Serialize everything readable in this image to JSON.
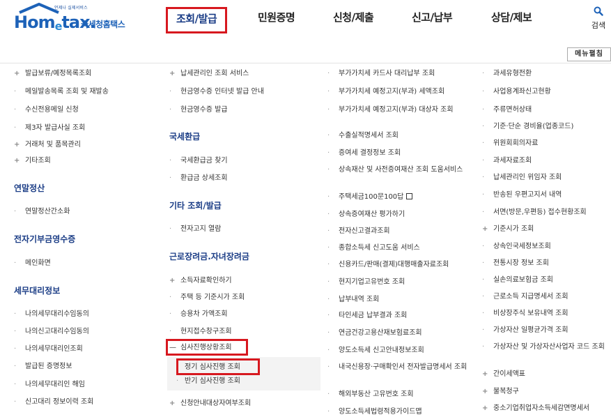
{
  "header": {
    "logo_small": "언제나 실제서비스",
    "logo_main": "Hom",
    "logo_e": "e",
    "logo_tax": "tax.",
    "logo_kor": "국세청홈택스",
    "nav": [
      "조회/발급",
      "민원증명",
      "신청/제출",
      "신고/납부",
      "상담/제보"
    ],
    "search_label": "검색"
  },
  "menu_map_button": "메뉴펼침",
  "col1": {
    "items": [
      "발급보류/예정목록조회",
      "메일발송목록 조회 및 재발송",
      "수신전용메일 신청",
      "제3자 발급사실 조회",
      "거래처 및 품목관리",
      "기타조회"
    ],
    "section1": "연말정산",
    "section1_items": [
      "연말정산간소화"
    ],
    "section2": "전자기부금영수증",
    "section2_items": [
      "메인화면"
    ],
    "section3": "세무대리정보",
    "section3_items": [
      "나의세무대리수임동의",
      "나의신고대리수임동의",
      "나의세무대리인조회",
      "발급된 증명정보",
      "나의세무대리인 해임",
      "신고대리 정보이력 조회"
    ]
  },
  "col2": {
    "items": [
      "납세관리인 조회 서비스",
      "현금영수증 인터넷 발급 안내",
      "현금영수증 발급"
    ],
    "section1": "국세환급",
    "section1_items": [
      "국세환급금 찾기",
      "환급금 상세조회"
    ],
    "section2": "기타 조회/발급",
    "section2_items": [
      "전자고지 열람"
    ],
    "section3": "근로장려금.자녀장려금",
    "section3_items": [
      "소득자료확인하기",
      "주택 등 기준시가 조회",
      "승용차 가액조회",
      "현지접수창구조회",
      "심사진행상황조회"
    ],
    "sub_items": [
      "정기 심사진행 조회",
      "반기 심사진행 조회"
    ],
    "last_item": "신청안내대상자여부조회"
  },
  "col3": {
    "items": [
      "부가가치세 카드사 대리납부 조회",
      "부가가치세 예정고지(부과) 세액조회",
      "부가가치세 예정고지(부과) 대상자 조회",
      "수출실적명세서 조회",
      "증여세 결정정보 조회",
      "상속재산 및 사전증여재산 조회 도움서비스",
      "주택세금100문100답",
      "상속증여재산 평가하기",
      "전자신고결과조회",
      "종합소득세 신고도움 서비스",
      "신용카드/판매(결제)대행매출자료조회",
      "현지기업고유번호 조회",
      "납부내역 조회",
      "타인세금 납부결과 조회",
      "연금건강고용산재보험료조회",
      "양도소득세 신고안내정보조회",
      "내국신용장·구매확인서 전자발급명세서 조회",
      "해외부동산 고유번호 조회",
      "양도소득세법령적용가이드맵"
    ]
  },
  "col4": {
    "items": [
      "과세유형전환",
      "사업용계좌신고현황",
      "주류면허상태",
      "기준·단순 경비율(업종코드)",
      "위원회회의자료",
      "과세자료조회",
      "납세관리인 위임자 조회",
      "반송된 우편고지서 내역",
      "서면(방문,우편등) 접수현황조회",
      "기준시가 조회",
      "상속인국세정보조회",
      "전통시장 정보 조회",
      "실손의료보험금 조회",
      "근로소득 지급명세서 조회",
      "비상장주식 보유내역 조회",
      "가상자산 일평균가격 조회",
      "가상자산 및 가상자산사업자 코드 조회",
      "간이세액표",
      "불복청구",
      "중소기업취업자소득세감면명세서"
    ]
  },
  "colors": {
    "accent_red": "#d7181f",
    "brand_blue": "#1d62b8",
    "section_navy": "#1b3d86"
  }
}
